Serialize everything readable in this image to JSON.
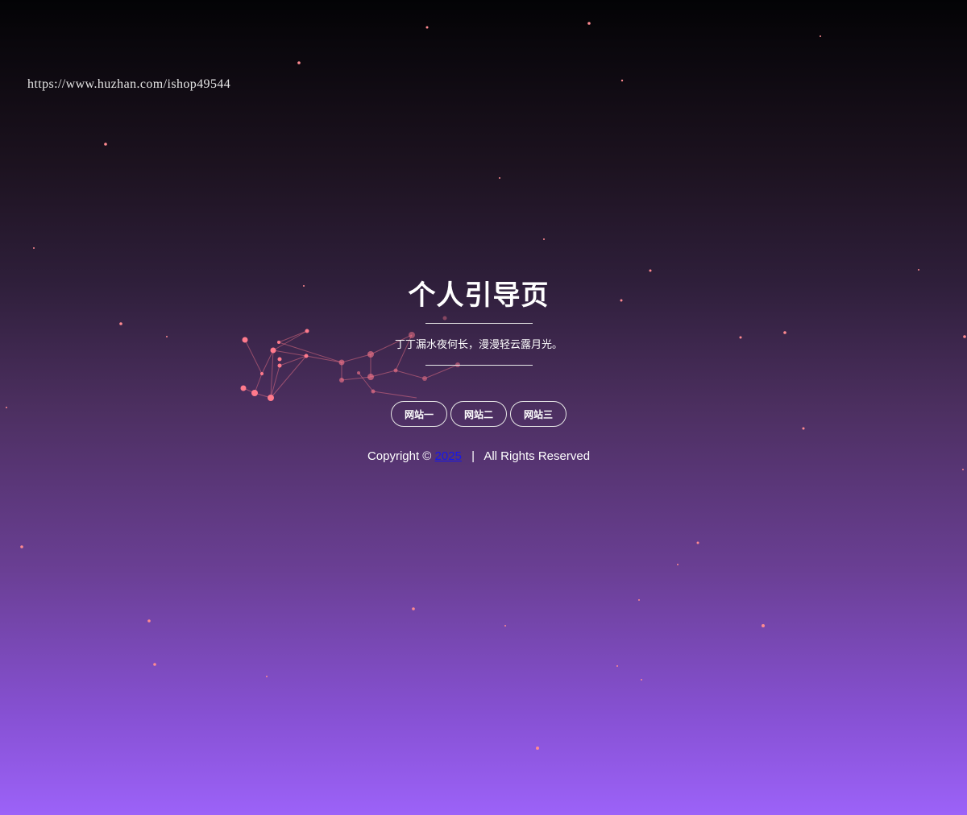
{
  "url_text": "https://www.huzhan.com/ishop49544",
  "title": "个人引导页",
  "subtitle": "丁丁漏水夜何长，漫漫轻云露月光。",
  "buttons": [
    {
      "label": "网站一"
    },
    {
      "label": "网站二"
    },
    {
      "label": "网站三"
    }
  ],
  "footer": {
    "copyright_label": "Copyright ©",
    "year_link": "2025",
    "separator": "|",
    "rights": "All Rights Reserved"
  },
  "colors": {
    "particle": "#ff7a8c",
    "link": "#1717e8",
    "gradient_top": "#030305",
    "gradient_bottom": "#9c62f8"
  }
}
